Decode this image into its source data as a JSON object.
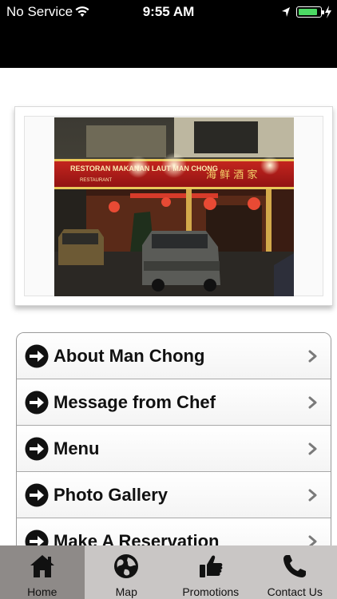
{
  "status": {
    "carrier": "No Service",
    "time": "9:55 AM",
    "battery_level": 0.9,
    "icons": [
      "wifi-icon",
      "location-arrow-icon",
      "battery-icon",
      "charging-bolt-icon"
    ]
  },
  "hero": {
    "image": "restaurant-storefront-photo",
    "sign_text": "RESTORAN MAKANAN LAUT MAN CHONG",
    "sign_subtext": "RESTAURANT"
  },
  "menu": {
    "items": [
      {
        "label": "About Man Chong",
        "icon": "arrow-circle-icon"
      },
      {
        "label": "Message from Chef",
        "icon": "arrow-circle-icon"
      },
      {
        "label": "Menu",
        "icon": "arrow-circle-icon"
      },
      {
        "label": "Photo Gallery",
        "icon": "arrow-circle-icon"
      },
      {
        "label": "Make A Reservation",
        "icon": "arrow-circle-icon"
      }
    ]
  },
  "tabs": [
    {
      "label": "Home",
      "icon": "home-icon",
      "active": true
    },
    {
      "label": "Map",
      "icon": "globe-icon",
      "active": false
    },
    {
      "label": "Promotions",
      "icon": "thumbs-up-icon",
      "active": false
    },
    {
      "label": "Contact Us",
      "icon": "phone-icon",
      "active": false
    }
  ],
  "colors": {
    "tab_bar": "#c9c6c5",
    "tab_active": "#8e8a88",
    "battery_fill": "#4cd964",
    "sign_red": "#b51a1a"
  }
}
